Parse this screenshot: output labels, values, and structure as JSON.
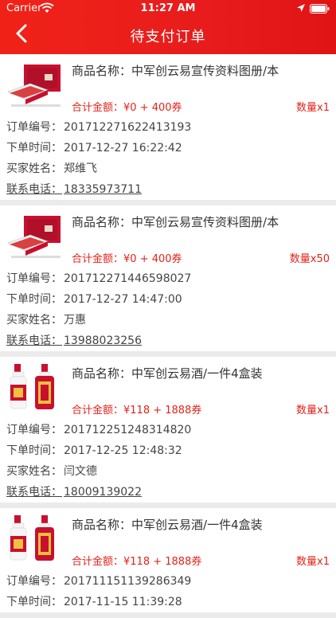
{
  "status_bar": {
    "carrier": "Carrier",
    "time": "11:27 AM"
  },
  "nav": {
    "title": "待支付订单",
    "back_icon": "chevron-left-icon"
  },
  "colors": {
    "brand": "#e8201a",
    "price": "#e3231b"
  },
  "labels": {
    "product_name": "商品名称：",
    "total": "合计金额：",
    "order_no": "订单编号：",
    "order_time": "下单时间：",
    "buyer": "买家姓名：",
    "phone": "联系电话："
  },
  "orders": [
    {
      "product": "中军创云易宣传资料图册/本",
      "thumb": "brochure",
      "total": "¥0 + 400券",
      "qty": "数量x1",
      "order_no": "201712271622413193",
      "order_time": "2017-12-27 16:22:42",
      "buyer": "郑维飞",
      "phone": "18335973711"
    },
    {
      "product": "中军创云易宣传资料图册/本",
      "thumb": "brochure",
      "total": "¥0 + 400券",
      "qty": "数量x50",
      "order_no": "201712271446598027",
      "order_time": "2017-12-27 14:47:00",
      "buyer": "万惠",
      "phone": "13988023256"
    },
    {
      "product": "中军创云易酒/一件4盒装",
      "thumb": "liquor",
      "total": "¥118 + 1888券",
      "qty": "数量x1",
      "order_no": "201712251248314820",
      "order_time": "2017-12-25 12:48:32",
      "buyer": "闫文德",
      "phone": "18009139022"
    },
    {
      "product": "中军创云易酒/一件4盒装",
      "thumb": "liquor",
      "total": "¥118 + 1888券",
      "qty": "数量x1",
      "order_no": "201711151139286349",
      "order_time": "2017-11-15 11:39:28",
      "buyer": "",
      "phone": ""
    }
  ]
}
